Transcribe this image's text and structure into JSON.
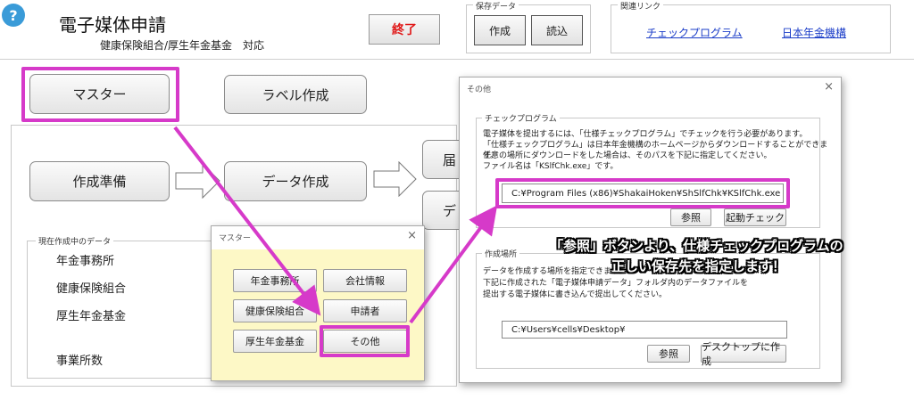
{
  "header": {
    "help_glyph": "?",
    "app_title": "電子媒体申請",
    "subtitle": "健康保険組合/厚生年金基金　対応",
    "exit_label": "終了"
  },
  "save_data": {
    "title": "保存データ",
    "create_label": "作成",
    "load_label": "読込"
  },
  "related_links": {
    "title": "関連リンク",
    "link1": "チェックプログラム",
    "link2": "日本年金機構"
  },
  "main": {
    "master_label": "マスター",
    "label_make": "ラベル作成",
    "prep_label": "作成準備",
    "data_make_label": "データ作成",
    "partial1": "届",
    "partial2": "デ",
    "current_data_title": "現在作成中のデータ",
    "rows": [
      "年金事務所",
      "健康保険組合",
      "厚生年金基金",
      "事業所数"
    ]
  },
  "master_dialog": {
    "title": "マスター",
    "close": "×",
    "buttons": [
      "年金事務所",
      "会社情報",
      "健康保険組合",
      "申請者",
      "厚生年金基金",
      "その他"
    ]
  },
  "other_dialog": {
    "title": "その他",
    "close": "×",
    "check_group_title": "チェックプログラム",
    "check_desc": [
      "電子媒体を提出するには、「仕様チェックプログラム」でチェックを行う必要があります。",
      "「仕様チェックプログラム」は日本年金機構のホームページからダウンロードすることができます。",
      "任意の場所にダウンロードをした場合は、そのパスを下記に指定してください。",
      "ファイル名は「KSlfChk.exe」です。"
    ],
    "check_path": "C:¥Program Files (x86)¥ShakaiHoken¥ShSlfChk¥KSlfChk.exe",
    "browse_label": "参照",
    "start_check_label": "起動チェック",
    "location_group_title": "作成場所",
    "location_desc": [
      "データを作成する場所を指定できます。",
      "下記に作成された「電子媒体申請データ」フォルダ内のデータファイルを",
      "提出する電子媒体に書き込んで提出してください。"
    ],
    "location_path": "C:¥Users¥cells¥Desktop¥",
    "browse2_label": "参照",
    "desktop_label": "デスクトップに作成"
  },
  "callout": {
    "line1": "「参照」ボタンより、仕様チェックプログラムの",
    "line2": "正しい保存先を指定します！"
  },
  "colors": {
    "highlight": "#d63ac9",
    "exit_text": "#e01818",
    "link": "#1a3cc8",
    "master_dialog_bg": "#fdf8c6",
    "help_icon": "#3a9bd8"
  }
}
